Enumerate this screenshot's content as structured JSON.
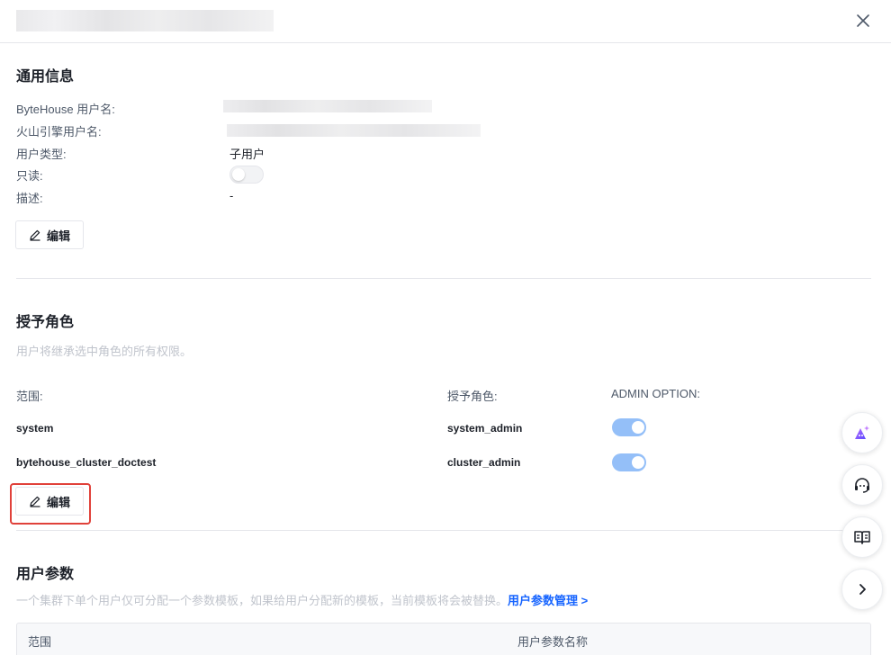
{
  "header": {
    "close_icon": "close-icon"
  },
  "general": {
    "title": "通用信息",
    "fields": [
      {
        "label": "ByteHouse 用户名:"
      },
      {
        "label": "火山引擎用户名:"
      },
      {
        "label": "用户类型:",
        "value": "子用户"
      },
      {
        "label": "只读:",
        "readonly_on": false
      },
      {
        "label": "描述:",
        "value": "-"
      }
    ],
    "edit_label": "编辑"
  },
  "roles": {
    "title": "授予角色",
    "description": "用户将继承选中角色的所有权限。",
    "columns": [
      "范围:",
      "授予角色:",
      "ADMIN OPTION:"
    ],
    "rows": [
      {
        "scope": "system",
        "role": "system_admin",
        "admin_option": true
      },
      {
        "scope": "bytehouse_cluster_doctest",
        "role": "cluster_admin",
        "admin_option": true
      }
    ],
    "edit_label": "编辑"
  },
  "params": {
    "title": "用户参数",
    "description": "一个集群下单个用户仅可分配一个参数模板，如果给用户分配新的模板，当前模板将会被替换。",
    "link_label": "用户参数管理 >",
    "columns": [
      "范围",
      "用户参数名称"
    ]
  },
  "floating": {
    "icons": [
      "ai-assistant-icon",
      "support-headset-icon",
      "docs-book-icon",
      "chevron-right-icon"
    ]
  },
  "colors": {
    "accent": "#1664ff",
    "switch_on": "#94bff8",
    "highlight": "#e0413a"
  }
}
